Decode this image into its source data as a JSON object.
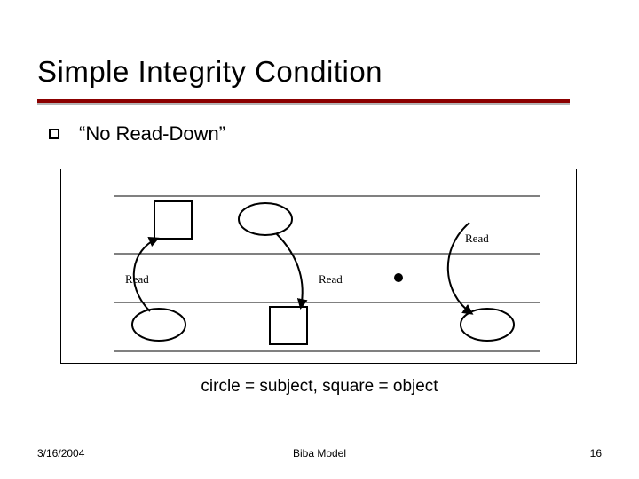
{
  "title": "Simple Integrity Condition",
  "bullet": "“No Read-Down”",
  "diagram": {
    "labels": {
      "read_left": "Read",
      "read_mid": "Read",
      "read_right": "Read"
    }
  },
  "legend": "circle = subject, square = object",
  "footer": {
    "date": "3/16/2004",
    "center": "Biba Model",
    "page": "16"
  }
}
